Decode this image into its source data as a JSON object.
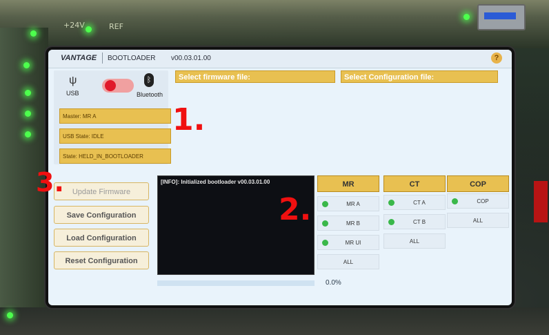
{
  "board": {
    "silkscreen": [
      "+24V",
      "REF"
    ]
  },
  "app": {
    "brand": "VANTAGE",
    "name": "BOOTLOADER",
    "version": "v00.03.01.00",
    "help_label": "?"
  },
  "connection": {
    "usb_label": "USB",
    "bluetooth_label": "Bluetooth",
    "mode": "usb",
    "master": "Master: MR A",
    "usb_state": "USB State:   IDLE",
    "state": "State: HELD_IN_BOOTLOADER"
  },
  "headers": {
    "firmware_file": "Select firmware file:",
    "config_file": "Select Configuration file:"
  },
  "actions": {
    "update_firmware": "Update Firmware",
    "save_configuration": "Save Configuration",
    "load_configuration": "Load Configuration",
    "reset_configuration": "Reset Configuration"
  },
  "console": {
    "log": "[INFO]: Initialized bootloader v00.03.01.00"
  },
  "progress": {
    "value": 0.0,
    "label": "0.0%"
  },
  "groups": {
    "mr": {
      "title": "MR",
      "items": [
        "MR A",
        "MR B",
        "MR UI",
        "ALL"
      ]
    },
    "ct": {
      "title": "CT",
      "items": [
        "CT A",
        "CT B",
        "ALL"
      ]
    },
    "cop": {
      "title": "COP",
      "items": [
        "COP",
        "ALL"
      ]
    }
  },
  "annotations": {
    "one": "1.",
    "two": "2.",
    "three": "3."
  },
  "colors": {
    "accent": "#e8c051",
    "status_green": "#3ab84a",
    "toggle_red": "#e0192a",
    "progress_blue": "#3b8ed6"
  }
}
